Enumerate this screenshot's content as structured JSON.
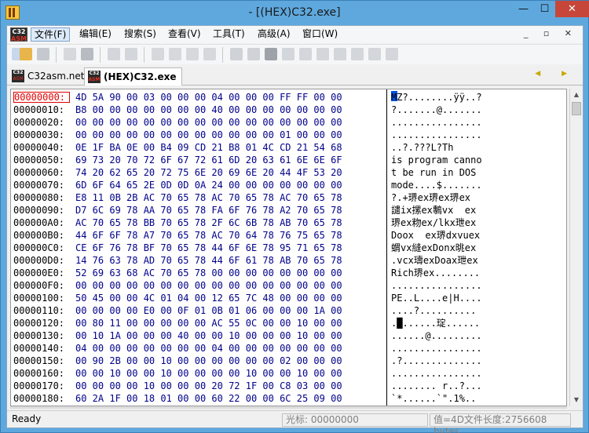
{
  "window": {
    "title": "- [(HEX)C32.exe]",
    "min": "—",
    "max": "☐",
    "close": "✕"
  },
  "menu": {
    "logo_top": "C32",
    "logo_bottom": "ASM",
    "items": [
      "文件(F)",
      "编辑(E)",
      "搜索(S)",
      "查看(V)",
      "工具(T)",
      "高级(A)",
      "窗口(W)"
    ],
    "mdi": "_ ▫ ✕"
  },
  "tabs": [
    {
      "label": "C32asm.net"
    },
    {
      "label": "(HEX)C32.exe"
    }
  ],
  "tab_arrows": "◀ ▶",
  "hex": {
    "rows": [
      {
        "addr": "00000000:",
        "bytes": "4D 5A 90 00 03 00 00 00 04 00 00 00 FF FF 00 00",
        "ascii": "MZ?........ÿÿ..?"
      },
      {
        "addr": "00000010:",
        "bytes": "B8 00 00 00 00 00 00 00 40 00 00 00 00 00 00 00",
        "ascii": "?.......@......."
      },
      {
        "addr": "00000020:",
        "bytes": "00 00 00 00 00 00 00 00 00 00 00 00 00 00 00 00",
        "ascii": "................"
      },
      {
        "addr": "00000030:",
        "bytes": "00 00 00 00 00 00 00 00 00 00 00 00 01 00 00 00",
        "ascii": "................"
      },
      {
        "addr": "00000040:",
        "bytes": "0E 1F BA 0E 00 B4 09 CD 21 B8 01 4C CD 21 54 68",
        "ascii": "..?.???L?Th"
      },
      {
        "addr": "00000050:",
        "bytes": "69 73 20 70 72 6F 67 72 61 6D 20 63 61 6E 6E 6F",
        "ascii": "is program canno"
      },
      {
        "addr": "00000060:",
        "bytes": "74 20 62 65 20 72 75 6E 20 69 6E 20 44 4F 53 20",
        "ascii": "t be run in DOS "
      },
      {
        "addr": "00000070:",
        "bytes": "6D 6F 64 65 2E 0D 0D 0A 24 00 00 00 00 00 00 00",
        "ascii": "mode....$......."
      },
      {
        "addr": "00000080:",
        "bytes": "E8 11 0B 2B AC 70 65 78 AC 70 65 78 AC 70 65 78",
        "ascii": "?.+琾ex琾ex琾ex"
      },
      {
        "addr": "00000090:",
        "bytes": "D7 6C 69 78 AA 70 65 78 FA 6F 76 78 A2 70 65 78",
        "ascii": "譴ix摞ex鷒vx  ex"
      },
      {
        "addr": "000000A0:",
        "bytes": "AC 70 65 78 BB 70 65 78 2F 6C 6B 78 AB 70 65 78",
        "ascii": "琾ex粅ex/lkx玴ex"
      },
      {
        "addr": "000000B0:",
        "bytes": "44 6F 6F 78 A7 70 65 78 AC 70 64 78 76 75 65 78",
        "ascii": "Doox  ex琾dxvuex"
      },
      {
        "addr": "000000C0:",
        "bytes": "CE 6F 76 78 BF 70 65 78 44 6F 6E 78 95 71 65 78",
        "ascii": "蝟vx縫exDonx晀ex"
      },
      {
        "addr": "000000D0:",
        "bytes": "14 76 63 78 AD 70 65 78 44 6F 61 78 AB 70 65 78",
        "ascii": ".vcx璹exDoax玴ex"
      },
      {
        "addr": "000000E0:",
        "bytes": "52 69 63 68 AC 70 65 78 00 00 00 00 00 00 00 00",
        "ascii": "Rich琾ex........"
      },
      {
        "addr": "000000F0:",
        "bytes": "00 00 00 00 00 00 00 00 00 00 00 00 00 00 00 00",
        "ascii": "................"
      },
      {
        "addr": "00000100:",
        "bytes": "50 45 00 00 4C 01 04 00 12 65 7C 48 00 00 00 00",
        "ascii": "PE..L....e|H...."
      },
      {
        "addr": "00000110:",
        "bytes": "00 00 00 00 E0 00 0F 01 0B 01 06 00 00 00 1A 00",
        "ascii": "....?.........."
      },
      {
        "addr": "00000120:",
        "bytes": "00 80 11 00 00 00 00 00 AC 55 0C 00 00 10 00 00",
        "ascii": ".█......琔......"
      },
      {
        "addr": "00000130:",
        "bytes": "00 10 1A 00 00 00 40 00 00 10 00 00 00 10 00 00",
        "ascii": "......@........."
      },
      {
        "addr": "00000140:",
        "bytes": "04 00 00 00 00 00 00 00 04 00 00 00 00 00 00 00",
        "ascii": "................"
      },
      {
        "addr": "00000150:",
        "bytes": "00 90 2B 00 00 10 00 00 00 00 00 00 02 00 00 00",
        "ascii": ".?.............."
      },
      {
        "addr": "00000160:",
        "bytes": "00 00 10 00 00 10 00 00 00 00 10 00 00 10 00 00",
        "ascii": "................"
      },
      {
        "addr": "00000170:",
        "bytes": "00 00 00 00 10 00 00 00 20 72 1F 00 C8 03 00 00",
        "ascii": "........ r..?..."
      },
      {
        "addr": "00000180:",
        "bytes": "60 2A 1F 00 18 01 00 00 60 22 00 00 6C 25 09 00",
        "ascii": "`*......`\".1%.."
      },
      {
        "addr": "00000190:",
        "bytes": "00 00 00 00 00 00 00 00 00 00 00 00 00 00 00 00",
        "ascii": "................"
      }
    ]
  },
  "status": {
    "ready": "Ready",
    "cursor": "光标: 00000000",
    "value": "值=4D文件长度:2756608 bytes"
  }
}
